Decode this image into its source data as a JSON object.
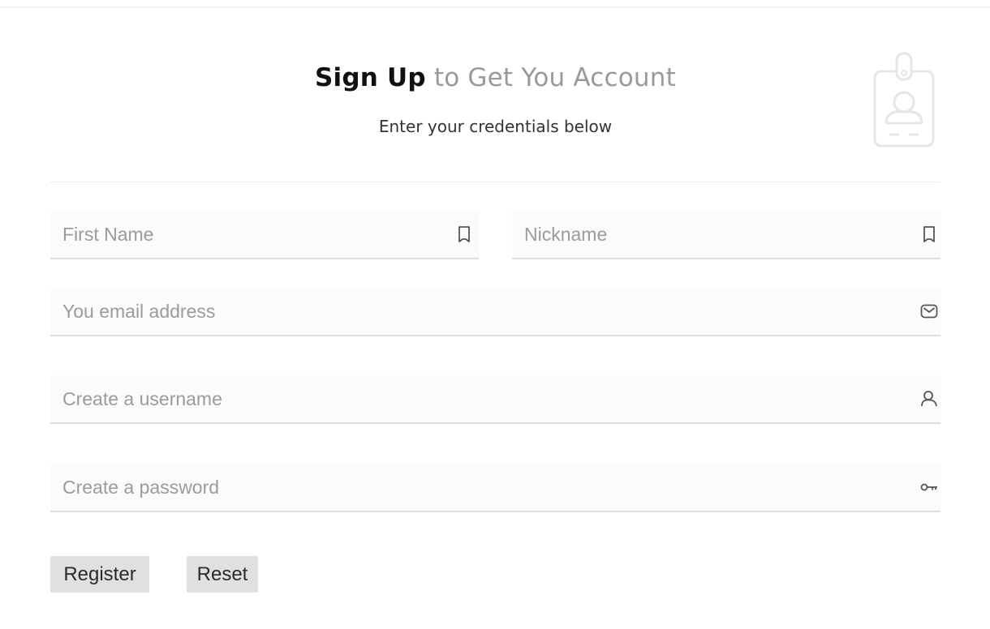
{
  "header": {
    "title_strong": "Sign Up",
    "title_rest": " to Get You Account",
    "subtitle": "Enter your credentials below"
  },
  "icons": {
    "header": "id-badge-icon",
    "first_name": "bookmark-icon",
    "nickname": "bookmark-icon",
    "email": "envelope-icon",
    "username": "user-icon",
    "password": "key-icon"
  },
  "form": {
    "first_name": {
      "placeholder": "First Name",
      "value": ""
    },
    "nickname": {
      "placeholder": "Nickname",
      "value": ""
    },
    "email": {
      "placeholder": "You email address",
      "value": ""
    },
    "username": {
      "placeholder": "Create a username",
      "value": ""
    },
    "password": {
      "placeholder": "Create a password",
      "value": ""
    }
  },
  "buttons": {
    "register": "Register",
    "reset": "Reset"
  },
  "colors": {
    "title_accent": "#9a9a9a",
    "field_underline": "#dedede",
    "button_bg": "#e0e0e0",
    "icon": "#555555"
  }
}
